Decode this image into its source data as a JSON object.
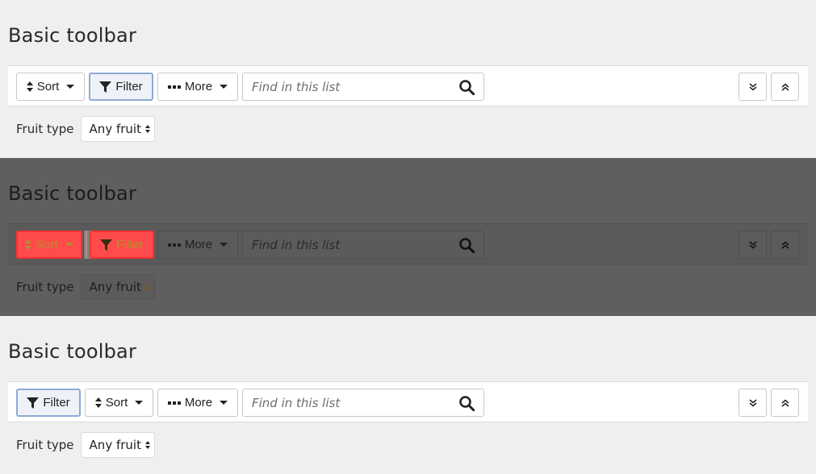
{
  "sections": [
    {
      "title": "Basic toolbar",
      "buttons": {
        "sort": "Sort",
        "filter": "Filter",
        "more": "More"
      },
      "search": {
        "placeholder": "Find in this list"
      },
      "filter": {
        "label": "Fruit type",
        "value": "Any fruit"
      }
    },
    {
      "title": "Basic toolbar",
      "buttons": {
        "sort": "Sort",
        "filter": "Filter",
        "more": "More"
      },
      "search": {
        "placeholder": "Find in this list"
      },
      "filter": {
        "label": "Fruit type",
        "value": "Any fruit"
      }
    },
    {
      "title": "Basic toolbar",
      "buttons": {
        "filter": "Filter",
        "sort": "Sort",
        "more": "More"
      },
      "search": {
        "placeholder": "Find in this list"
      },
      "filter": {
        "label": "Fruit type",
        "value": "Any fruit"
      }
    }
  ],
  "icons": [
    "sort-icon",
    "filter-icon",
    "more-icon",
    "search-icon",
    "collapse-down-icon",
    "collapse-up-icon",
    "select-arrows-icon"
  ],
  "colors": {
    "overlay": "#5f5f5f",
    "highlight": "#ff4b4b",
    "pressed_border": "#8fa8d4",
    "background": "#efefef"
  }
}
